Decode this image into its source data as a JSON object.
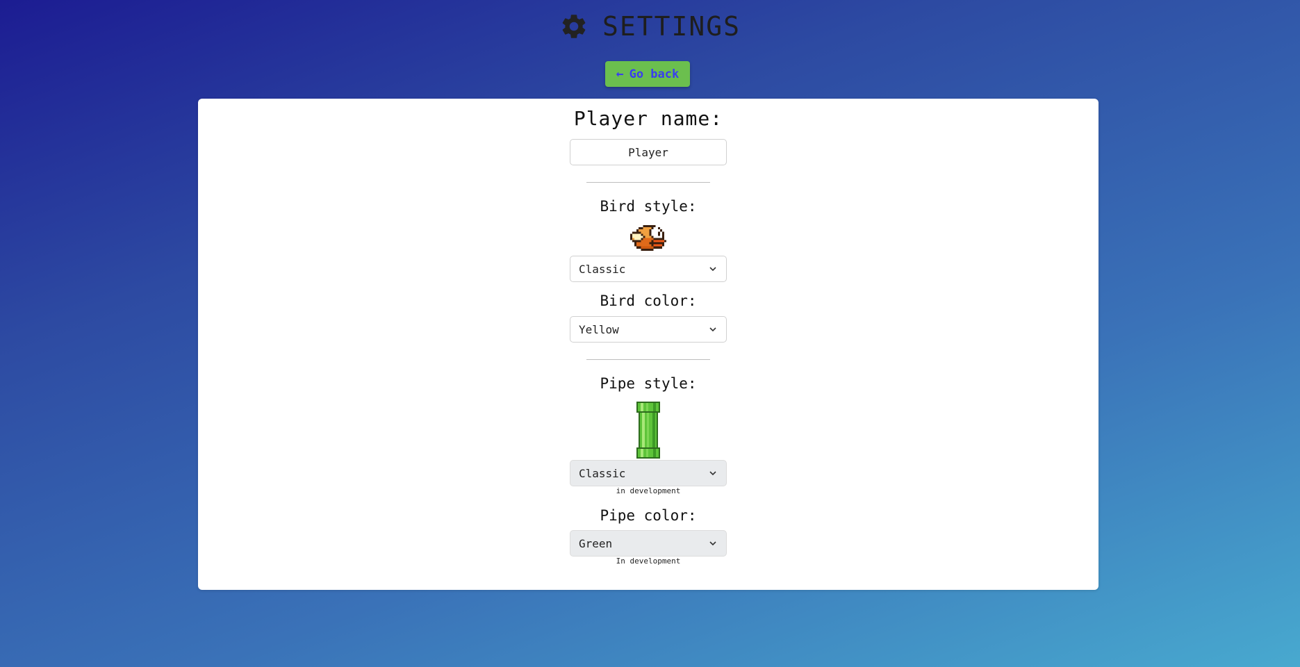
{
  "header": {
    "title": "SETTINGS",
    "icon": "gear-icon"
  },
  "back_button": {
    "label": "Go back",
    "icon": "arrow-left-icon",
    "color": "#6bbf4e"
  },
  "player": {
    "label": "Player name:",
    "value": "Player"
  },
  "bird": {
    "style_label": "Bird style:",
    "style_value": "Classic",
    "color_label": "Bird color:",
    "color_value": "Yellow"
  },
  "pipe": {
    "style_label": "Pipe style:",
    "style_value": "Classic",
    "style_note": "in development",
    "color_label": "Pipe color:",
    "color_value": "Green",
    "color_note": "In development"
  }
}
